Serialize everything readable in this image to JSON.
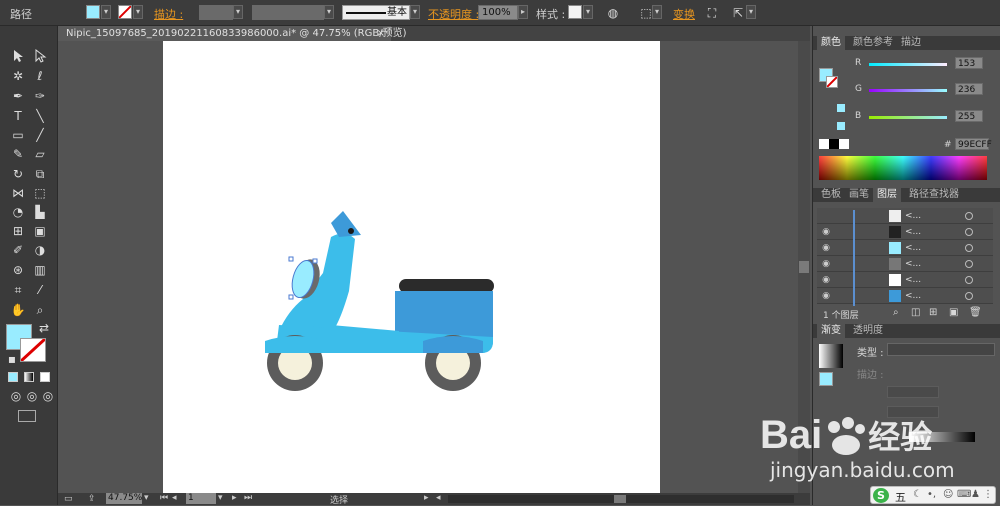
{
  "control_bar": {
    "object_type": "路径",
    "stroke_label": "描边 :",
    "stroke_profile": "基本",
    "opacity_label": "不透明度 :",
    "opacity_value": "100%",
    "style_label": "样式 :",
    "transform_label": "变换",
    "fill_color": "#99ECFF"
  },
  "document_tab": {
    "title": "Nipic_15097685_20190221160833986000.ai* @ 47.75% (RGB/预览)",
    "close": "×"
  },
  "status_bar": {
    "zoom": "47.75%",
    "artboard": "1",
    "tool_name": "选择"
  },
  "color_panel": {
    "tabs": [
      "颜色",
      "颜色参考",
      "描边"
    ],
    "r_label": "R",
    "g_label": "G",
    "b_label": "B",
    "r_value": "153",
    "g_value": "236",
    "b_value": "255",
    "hex_label": "#",
    "hex_value": "99ECFF"
  },
  "layers_panel": {
    "tabs": [
      "色板",
      "画笔",
      "图层",
      "路径查找器"
    ],
    "rows": [
      {
        "name": "<...",
        "visible": false
      },
      {
        "name": "<...",
        "visible": true
      },
      {
        "name": "<...",
        "visible": true
      },
      {
        "name": "<...",
        "visible": true
      },
      {
        "name": "<...",
        "visible": true
      },
      {
        "name": "<...",
        "visible": true
      }
    ],
    "count": "1 个图层"
  },
  "gradient_panel": {
    "tabs": [
      "渐变",
      "透明度"
    ],
    "type_label": "类型 :",
    "stroke_label": "描边 :"
  },
  "watermark": {
    "brand": "Bai",
    "brand2": "经验",
    "url": "jingyan.baidu.com",
    "ime": "五"
  }
}
